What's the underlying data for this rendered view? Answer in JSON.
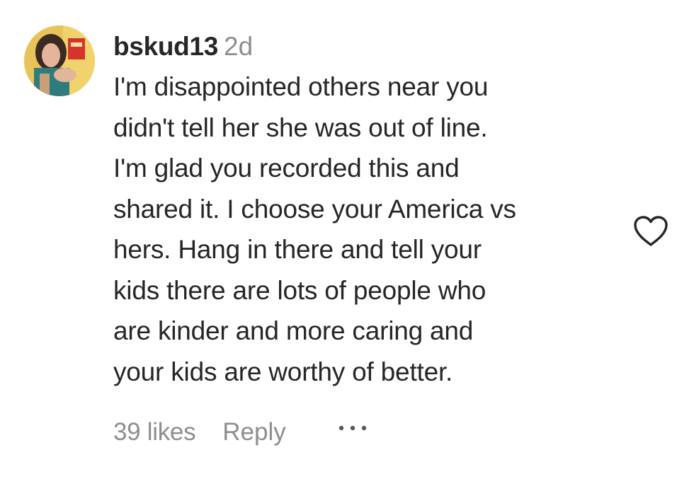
{
  "comment": {
    "username": "bskud13",
    "timestamp": "2d",
    "text_lines": [
      "I'm disappointed others near you",
      "didn't tell her she was out of line.",
      "I'm glad you recorded this and",
      "shared it. I choose your America vs",
      "hers. Hang in there and tell your",
      "kids there are lots of people who",
      "are kinder and more caring and",
      "your kids are worthy of better."
    ],
    "likes": "39 likes",
    "reply_label": "Reply"
  },
  "icons": {
    "more": "more-dots-icon",
    "like": "heart-outline-icon",
    "avatar": "user-avatar"
  },
  "colors": {
    "text": "#262626",
    "secondary": "#8e8e8e",
    "background": "#ffffff"
  }
}
